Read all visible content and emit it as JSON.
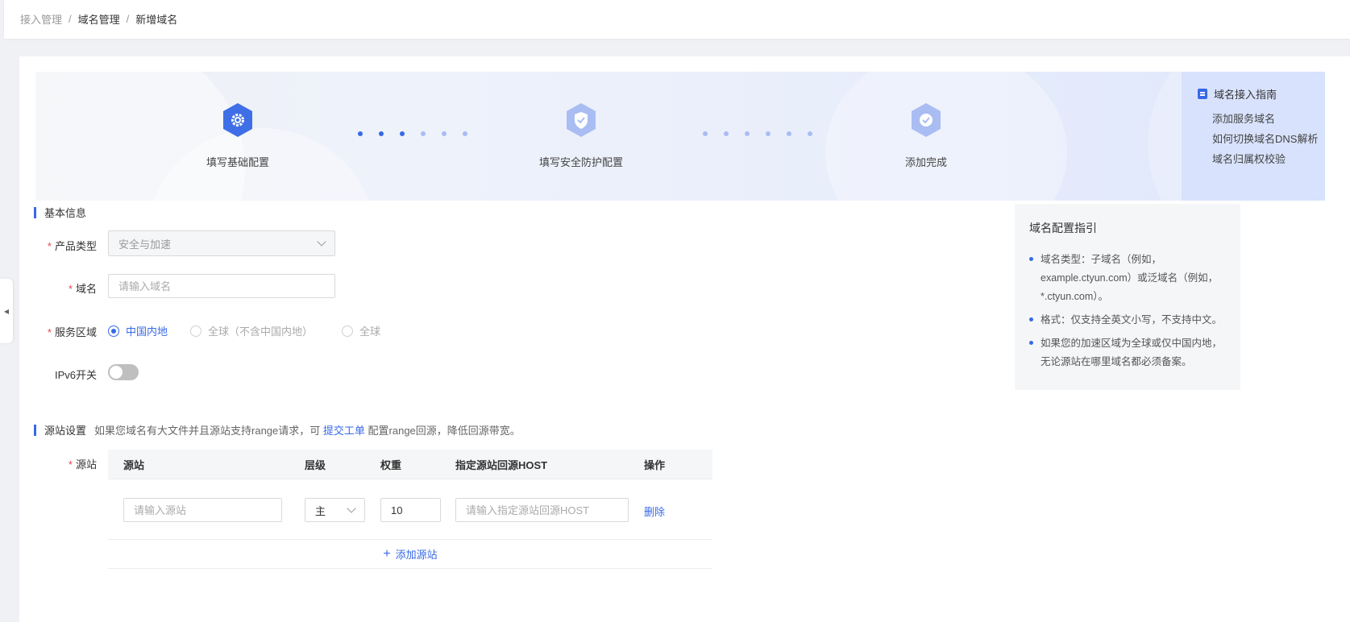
{
  "breadcrumb": {
    "items": [
      "接入管理",
      "域名管理",
      "新增域名"
    ],
    "sep": "/"
  },
  "steps": [
    {
      "label": "填写基础配置",
      "icon": "gear-icon"
    },
    {
      "label": "填写安全防护配置",
      "icon": "shield-icon"
    },
    {
      "label": "添加完成",
      "icon": "check-icon"
    }
  ],
  "guide": {
    "title": "域名接入指南",
    "links": [
      "添加服务域名",
      "如何切换域名DNS解析",
      "域名归属权校验"
    ]
  },
  "basic": {
    "title": "基本信息",
    "product_type_label": "产品类型",
    "product_type_value": "安全与加速",
    "domain_label": "域名",
    "domain_placeholder": "请输入域名",
    "region_label": "服务区域",
    "region_options": [
      "中国内地",
      "全球（不含中国内地）",
      "全球"
    ],
    "ipv6_label": "IPv6开关"
  },
  "side_guide": {
    "title": "域名配置指引",
    "items": [
      "域名类型：子域名（例如，example.ctyun.com）或泛域名（例如，*.ctyun.com）。",
      "格式：仅支持全英文小写，不支持中文。",
      "如果您的加速区域为全球或仅中国内地，无论源站在哪里域名都必须备案。"
    ]
  },
  "origin": {
    "title": "源站设置",
    "desc_before": "如果您域名有大文件并且源站支持range请求，可",
    "desc_link": "提交工单",
    "desc_after": "配置range回源，降低回源带宽。",
    "field_label": "源站",
    "columns": [
      "源站",
      "层级",
      "权重",
      "指定源站回源HOST",
      "操作"
    ],
    "row": {
      "source_placeholder": "请输入源站",
      "level": "主",
      "weight": "10",
      "host_placeholder": "请输入指定源站回源HOST",
      "action": "删除"
    },
    "add_label": "添加源站"
  },
  "colors": {
    "accent": "#3769e7",
    "required": "#e54545"
  }
}
